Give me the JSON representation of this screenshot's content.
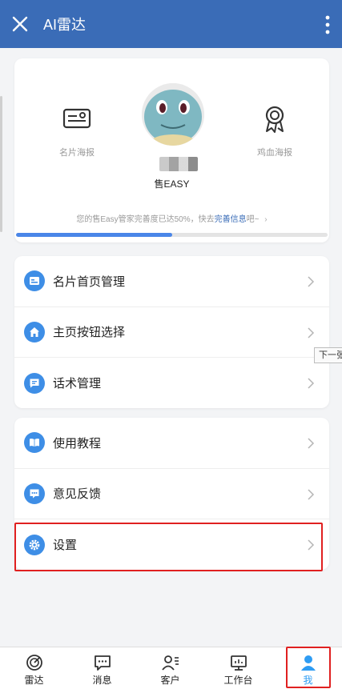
{
  "appbar": {
    "title": "AI雷达"
  },
  "profile": {
    "left_label": "名片海报",
    "right_label": "鸡血海报",
    "brand": "售EASY",
    "progress_text_prefix": "您的售Easy管家完善度已达50%，快去",
    "progress_link": "完善信息",
    "progress_text_suffix": "吧~",
    "progress_percent": 50
  },
  "menu_group_1": [
    {
      "label": "名片首页管理",
      "icon": "card-icon"
    },
    {
      "label": "主页按钮选择",
      "icon": "home-icon"
    },
    {
      "label": "话术管理",
      "icon": "message-icon"
    }
  ],
  "menu_group_2": [
    {
      "label": "使用教程",
      "icon": "book-icon"
    },
    {
      "label": "意见反馈",
      "icon": "feedback-icon"
    },
    {
      "label": "设置",
      "icon": "gear-icon"
    }
  ],
  "tooltip": "下一张",
  "tabs": [
    {
      "label": "雷达",
      "icon": "radar-icon"
    },
    {
      "label": "消息",
      "icon": "chat-icon"
    },
    {
      "label": "客户",
      "icon": "customers-icon"
    },
    {
      "label": "工作台",
      "icon": "workbench-icon"
    },
    {
      "label": "我",
      "icon": "person-icon",
      "active": true
    }
  ],
  "colors": {
    "appbar": "#3a6cb7",
    "accent": "#3e8ee6",
    "active_tab": "#2e9cf3",
    "highlight": "#e02020"
  }
}
